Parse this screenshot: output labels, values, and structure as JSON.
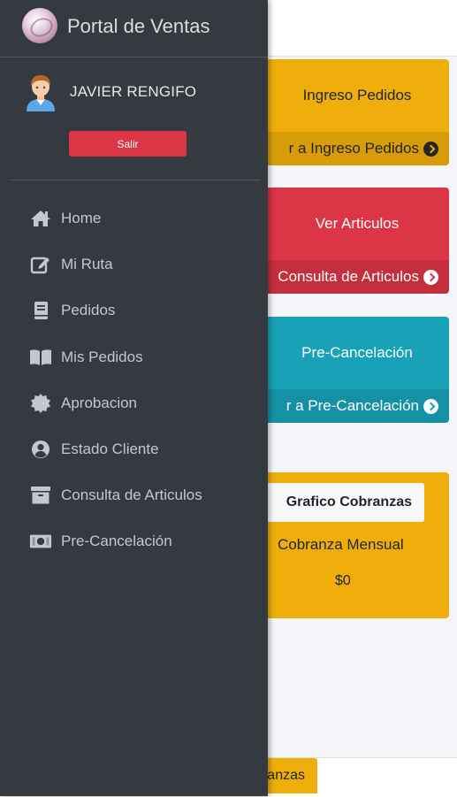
{
  "app": {
    "title": "Portal de Ventas"
  },
  "user": {
    "name": "JAVIER RENGIFO",
    "logout_label": "Salir"
  },
  "nav": {
    "items": [
      {
        "label": "Home",
        "icon": "home-icon"
      },
      {
        "label": "Mi Ruta",
        "icon": "edit-icon"
      },
      {
        "label": "Pedidos",
        "icon": "book-icon"
      },
      {
        "label": "Mis Pedidos",
        "icon": "open-book-icon"
      },
      {
        "label": "Aprobacion",
        "icon": "certificate-icon"
      },
      {
        "label": "Estado Cliente",
        "icon": "user-circle-icon"
      },
      {
        "label": "Consulta de Articulos",
        "icon": "archive-icon"
      },
      {
        "label": "Pre-Cancelación",
        "icon": "money-bill-icon"
      }
    ]
  },
  "cards": [
    {
      "title": "Ingreso Pedidos",
      "footer": "r a Ingreso Pedidos",
      "color": "#f0ae0a"
    },
    {
      "title": "Ver Articulos",
      "footer": "Consulta de Articulos",
      "color": "#dc3545"
    },
    {
      "title": "Pre-Cancelación",
      "footer": "r a Pre-Cancelación",
      "color": "#17a2b8"
    }
  ],
  "chart_card": {
    "button_label": "Grafico Cobranzas",
    "subtitle": "Cobranza Mensual",
    "value": "$0"
  },
  "bottom_tab": {
    "label": "anzas"
  }
}
